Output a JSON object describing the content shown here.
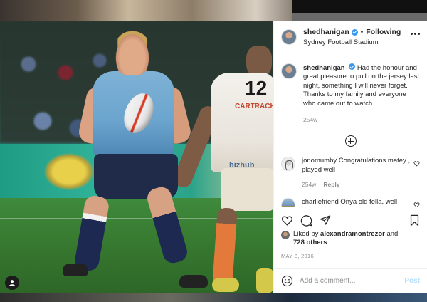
{
  "post": {
    "username": "shedhanigan",
    "follow_status": "Following",
    "separator": "•",
    "location": "Sydney Football Stadium"
  },
  "caption": {
    "username": "shedhanigan",
    "text": "Had the honour and great pleasure to pull on the jersey last night, something I will never forget. Thanks to my family and everyone who came out to watch.",
    "time": "254w"
  },
  "comments": [
    {
      "username": "jonomumby",
      "text": "Congratulations matey , played well",
      "time": "254w",
      "reply_label": "Reply"
    },
    {
      "username": "charliefriend",
      "text": "Onya old fella, well deserved",
      "time": "",
      "reply_label": ""
    }
  ],
  "likes": {
    "prefix": "Liked by",
    "user": "alexandramontrezor",
    "joiner": "and",
    "others": "728 others"
  },
  "post_date": "MAY 8, 2016",
  "add_comment": {
    "placeholder": "Add a comment...",
    "post_label": "Post"
  },
  "photo": {
    "jersey_number_p2": "12",
    "sponsor_p2": "CARTRACK",
    "shorts_text_p2": "bizhub"
  },
  "colors": {
    "verified_blue": "#3897f0",
    "post_button_disabled": "#b2dffc",
    "secondary_text": "#8e8e8e",
    "primary_text": "#262626"
  },
  "icons": [
    "verified-badge-icon",
    "more-options-icon",
    "load-more-comments-icon",
    "heart-icon",
    "comment-icon",
    "share-icon",
    "bookmark-icon",
    "emoji-icon",
    "user-tag-icon"
  ]
}
